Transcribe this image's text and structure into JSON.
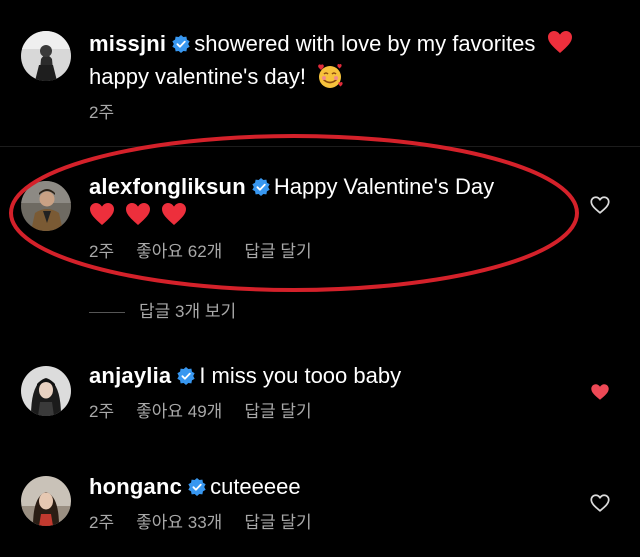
{
  "comments": [
    {
      "username": "missjni",
      "text": "showered with love by my favorites",
      "text2": "happy valentine's day!",
      "time": "2주",
      "likes": "",
      "reply": ""
    },
    {
      "username": "alexfongliksun",
      "text": "Happy Valentine's Day",
      "time": "2주",
      "likes": "좋아요 62개",
      "reply": "답글 달기",
      "liked": false
    },
    {
      "username": "anjaylia",
      "text": "I miss you tooo baby",
      "time": "2주",
      "likes": "좋아요 49개",
      "reply": "답글 달기",
      "liked": true
    },
    {
      "username": "honganc",
      "text": "cuteeeee",
      "time": "2주",
      "likes": "좋아요 33개",
      "reply": "답글 달기",
      "liked": false
    }
  ],
  "view_replies": "답글 3개 보기",
  "colors": {
    "background": "#000000",
    "verified": "#3897f0",
    "heart": "#ed4956",
    "highlight": "#d4212a",
    "meta": "#a8a8a8"
  }
}
